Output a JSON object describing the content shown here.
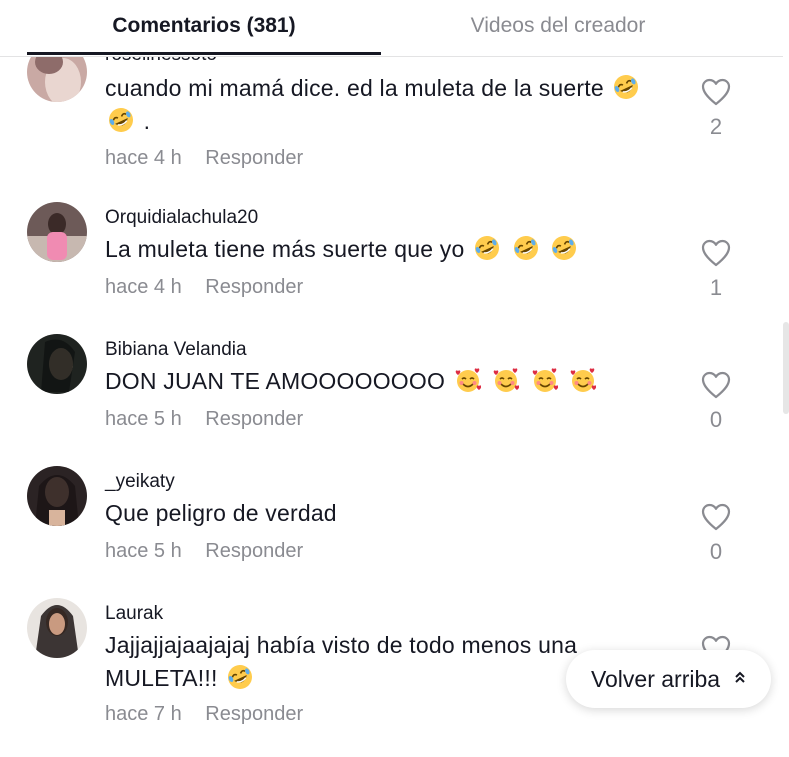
{
  "tabs": {
    "comments_label": "Comentarios (381)",
    "videos_label": "Videos del creador"
  },
  "comments": [
    {
      "username": "rosellnessoto",
      "text_parts": [
        "cuando mi mamá dice. ed la muleta de la suerte ",
        " ",
        " ."
      ],
      "time": "hace 4 h",
      "reply": "Responder",
      "likes": "2",
      "emoji": "rolling-on-floor-laughing"
    },
    {
      "username": "Orquidialachula20",
      "text": "La muleta tiene más suerte que yo",
      "time": "hace 4 h",
      "reply": "Responder",
      "likes": "1",
      "emoji": "rolling-on-floor-laughing"
    },
    {
      "username": "Bibiana Velandia",
      "text": "DON JUAN TE AMOOOOOOOO",
      "time": "hace 5 h",
      "reply": "Responder",
      "likes": "0",
      "emoji": "smiling-face-with-hearts"
    },
    {
      "username": "_yeikaty",
      "text": "Que peligro de verdad",
      "time": "hace 5 h",
      "reply": "Responder",
      "likes": "0"
    },
    {
      "username": "Laurak",
      "text_line1": "Jajjajjajaajajaj había visto de todo menos una",
      "text_line2": "MULETA!!!",
      "time": "hace 7 h",
      "reply": "Responder",
      "emoji": "rolling-on-floor-laughing"
    }
  ],
  "back_to_top": {
    "label": "Volver arriba",
    "icon": "double-chevron-up-icon"
  },
  "icons": {
    "like": "heart-outline-icon"
  },
  "colors": {
    "text": "#161823",
    "muted": "#8a8b91",
    "divider": "#e3e3e4"
  }
}
